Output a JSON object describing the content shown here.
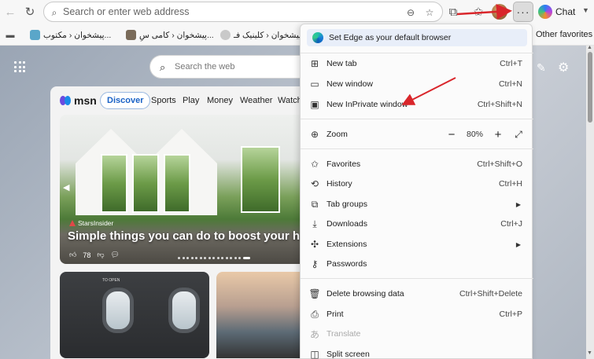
{
  "toolbar": {
    "address_placeholder": "Search or enter web address",
    "chat_label": "Chat"
  },
  "favorites": {
    "items": [
      {
        "label": "پیشخوان ‹ مکتوب..."
      },
      {
        "label": "پیشخوان ‹ کامی سِ..."
      },
      {
        "label": "پیشخوان ‹ کلینیک فـ..."
      }
    ],
    "other": "Other favorites"
  },
  "newtab": {
    "search_placeholder": "Search the web"
  },
  "msn": {
    "logo": "msn",
    "tabs": [
      "Discover",
      "Sports",
      "Play",
      "Money",
      "Weather",
      "Watch"
    ],
    "hero": {
      "source": "StarsInsider",
      "title": "Simple things you can do to boost your ho",
      "likes": "78"
    },
    "card2_label": "TO OPEN"
  },
  "menu": {
    "banner": "Set Edge as your default browser",
    "items": [
      {
        "label": "New tab",
        "shortcut": "Ctrl+T",
        "icon": "new-tab-icon"
      },
      {
        "label": "New window",
        "shortcut": "Ctrl+N",
        "icon": "new-window-icon"
      },
      {
        "label": "New InPrivate window",
        "shortcut": "Ctrl+Shift+N",
        "icon": "inprivate-icon"
      },
      {
        "label": "Zoom",
        "icon": "zoom-icon"
      },
      {
        "label": "Favorites",
        "shortcut": "Ctrl+Shift+O",
        "icon": "favorites-icon"
      },
      {
        "label": "History",
        "shortcut": "Ctrl+H",
        "icon": "history-icon"
      },
      {
        "label": "Tab groups",
        "icon": "tab-groups-icon"
      },
      {
        "label": "Downloads",
        "shortcut": "Ctrl+J",
        "icon": "downloads-icon"
      },
      {
        "label": "Extensions",
        "icon": "extensions-icon"
      },
      {
        "label": "Passwords",
        "icon": "passwords-icon"
      },
      {
        "label": "Delete browsing data",
        "shortcut": "Ctrl+Shift+Delete",
        "icon": "delete-icon"
      },
      {
        "label": "Print",
        "shortcut": "Ctrl+P",
        "icon": "print-icon"
      },
      {
        "label": "Translate",
        "icon": "translate-icon",
        "disabled": true
      },
      {
        "label": "Split screen",
        "icon": "split-screen-icon"
      }
    ],
    "zoom_value": "80%"
  },
  "colors": {
    "annotation": "#d9262b",
    "accent": "#1a62c6"
  }
}
